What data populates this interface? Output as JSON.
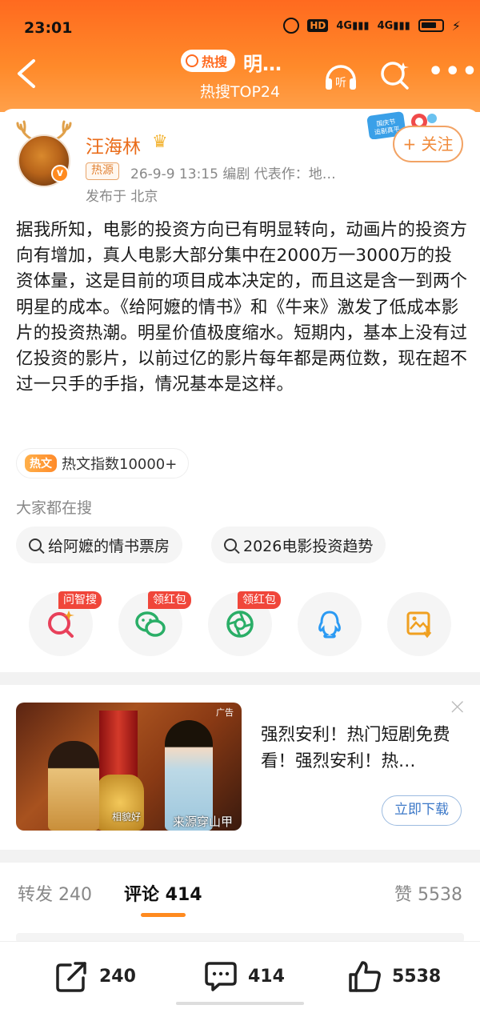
{
  "status_bar": {
    "time": "23:01",
    "hd": "HD",
    "signal1": "4G",
    "signal2": "4G"
  },
  "nav": {
    "hot_badge": "热搜",
    "title": "明…",
    "subtitle": "热搜TOP24",
    "listen_label": "听"
  },
  "post": {
    "author": "汪海林",
    "source_tag": "热源",
    "meta": "26-9-9 13:15   编剧  代表作：地…",
    "location": "发布于 北京",
    "follow_label": "+ 关注",
    "festival_badge": "国庆节追剧真平",
    "verified_mark": "v",
    "text": "据我所知，电影的投资方向已有明显转向，动画片的投资方向有增加，真人电影大部分集中在2000万一3000万的投资体量，这是目前的项目成本决定的，而且这是含一到两个明星的成本。《给阿嬷的情书》和《牛来》激发了低成本影片的投资热潮。明星价值极度缩水。短期内，基本上没有过亿投资的影片，以前过亿的影片每年都是两位数，现在超不过一只手的手指，情况基本是这样。",
    "hot_index_tag": "热文",
    "hot_index": "热文指数10000+"
  },
  "searches": {
    "label": "大家都在搜",
    "items": [
      {
        "text": "给阿嬷的情书票房"
      },
      {
        "text": "2026电影投资趋势"
      }
    ]
  },
  "share": {
    "items": [
      {
        "icon": "zhisou-icon",
        "tag": "问智搜",
        "color": "#e8405a"
      },
      {
        "icon": "wechat-icon",
        "tag": "领红包",
        "color": "#2aae67"
      },
      {
        "icon": "moments-icon",
        "tag": "领红包",
        "color": "#2aae67"
      },
      {
        "icon": "qq-icon",
        "tag": "",
        "color": "#2b9af3"
      },
      {
        "icon": "save-image-icon",
        "tag": "",
        "color": "#f0a020"
      }
    ]
  },
  "ad": {
    "title": "强烈安利！热门短剧免费看！强烈安利！热…",
    "download_label": "立即下载",
    "caption_left": "相貌好",
    "caption_right": "来源穿山甲",
    "corner": "广告",
    "close": "×"
  },
  "tabs": {
    "repost": "转发 240",
    "comment": "评论 414",
    "like": "赞 5538"
  },
  "bottom_bar": {
    "repost_count": "240",
    "comment_count": "414",
    "like_count": "5538"
  },
  "colors": {
    "accent": "#ff8a1f",
    "header": "#ff6a1f",
    "author": "#ea6c1a"
  }
}
